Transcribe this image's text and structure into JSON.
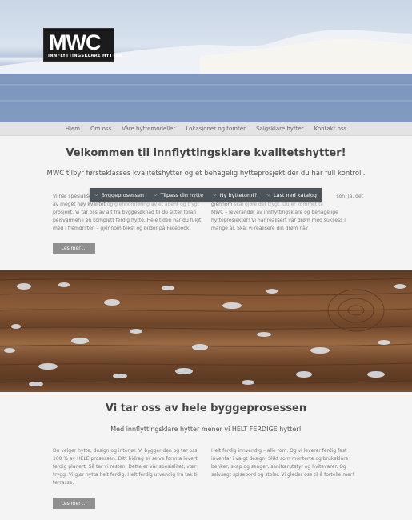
{
  "logo": {
    "mark": "MWC",
    "tagline": "INNFLYTTINGSKLARE HYTTER"
  },
  "nav": [
    "Hjem",
    "Om oss",
    "Våre hyttemodeller",
    "Lokasjoner og tomter",
    "Salgsklare hytter",
    "Kontakt oss"
  ],
  "section1": {
    "title": "Velkommen til innflyttingsklare kvalitetshytter!",
    "lead": "MWC tilbyr førsteklasses kvalitetshytter og et behagelig hytteprosjekt der du har full kontroll.",
    "left_lines": [
      "Vi har spesialisert",
      "av meget høy kvalitet",
      "prosjekt. Vi tar oss av alt fra byggesøknad til du sitter foran",
      "peisvarmen i en komplett ferdig hytte. Hele tiden har du fulgt",
      "med i fremdriften – gjennom tekst og bilder på Facebook."
    ],
    "left_frag": "og gjennomføring av et åpent og trygt",
    "right_frag": "son. Ja, det",
    "right_lines": [
      "gjennom",
      "MWC – leverandør av innflyttingsklare og behagelige",
      "hytteprosjekter! Vi har realisert vår drøm med  suksess i",
      "mange år. Skal vi realisere din drøm nå?"
    ],
    "right_line1": "skal gjøre det trygt. Du er kommet til",
    "button": "Les mer ..."
  },
  "dropbar": [
    "Byggeprosessen",
    "Tilpass din hytte",
    "Ny hyttetomt?",
    "Last ned katalog"
  ],
  "section2": {
    "title": "Vi tar oss av hele byggeprosessen",
    "lead": "Med innflyttingsklare hytter mener vi HELT FERDIGE hytter!",
    "left_lines": [
      "Du velger hytte, design og interiør. Vi bygger den og tar oss",
      "100 % av HELE prosessen. Ditt bidrag er selve formta levert",
      "ferdig planert. Så tar vi resten. Dette er vår spesialitet, vær",
      "trygg. Vi gjør hytta helt ferdig. Helt ferdig utvendig fra tak til",
      "terrasse."
    ],
    "right_lines": [
      "Helt ferdig innvendig – alle rom. Og vi leverer ferdig fast",
      "inventar i valgt design. Slikt som monterte og bruksklare",
      "benker, skap og senger, sanitærutstyr og hvitevarer. Og",
      "selvsagt spisebord og stoler. Vi gleder oss til å fortelle mer!"
    ],
    "button": "Les mer ..."
  }
}
